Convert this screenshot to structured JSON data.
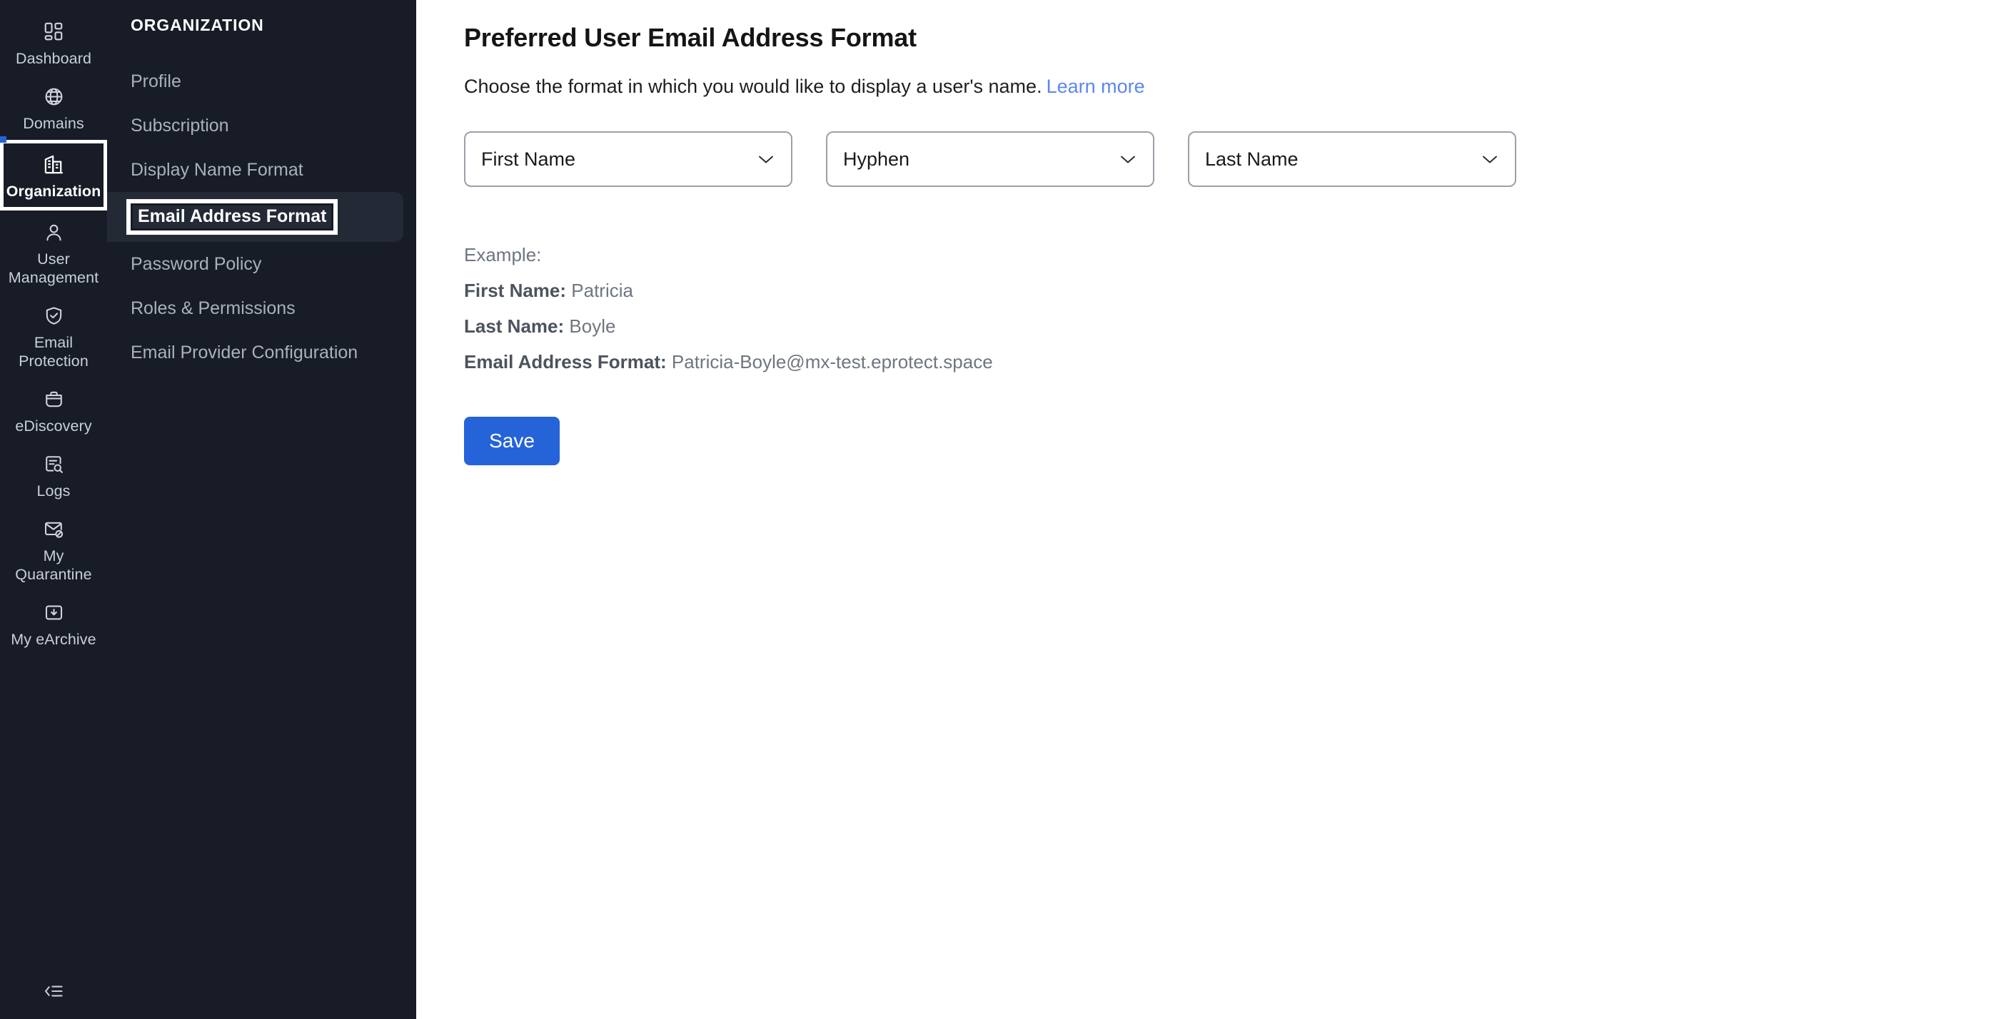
{
  "rail": {
    "items": [
      {
        "label": "Dashboard",
        "icon": "dashboard-grid-icon",
        "active": false
      },
      {
        "label": "Domains",
        "icon": "globe-icon",
        "active": false
      },
      {
        "label": "Organization",
        "icon": "building-icon",
        "active": true
      },
      {
        "label": "User Management",
        "icon": "user-icon",
        "active": false
      },
      {
        "label": "Email Protection",
        "icon": "shield-check-icon",
        "active": false
      },
      {
        "label": "eDiscovery",
        "icon": "briefcase-icon",
        "active": false
      },
      {
        "label": "Logs",
        "icon": "document-search-icon",
        "active": false
      },
      {
        "label": "My Quarantine",
        "icon": "envelope-blocked-icon",
        "active": false
      },
      {
        "label": "My eArchive",
        "icon": "archive-download-icon",
        "active": false
      }
    ],
    "collapse_icon": "collapse-sidebar-icon"
  },
  "subnav": {
    "title": "ORGANIZATION",
    "items": [
      {
        "label": "Profile",
        "active": false
      },
      {
        "label": "Subscription",
        "active": false
      },
      {
        "label": "Display Name Format",
        "active": false
      },
      {
        "label": "Email Address Format",
        "active": true
      },
      {
        "label": "Password Policy",
        "active": false
      },
      {
        "label": "Roles & Permissions",
        "active": false
      },
      {
        "label": "Email Provider Configuration",
        "active": false
      }
    ]
  },
  "main": {
    "title": "Preferred User Email Address Format",
    "description": "Choose the format in which you would like to display a user's name.",
    "learn_more_label": "Learn more",
    "selects": [
      {
        "name": "first-part",
        "value": "First Name"
      },
      {
        "name": "separator",
        "value": "Hyphen"
      },
      {
        "name": "last-part",
        "value": "Last Name"
      }
    ],
    "example": {
      "heading": "Example:",
      "first_name_label": "First Name:",
      "first_name_value": "Patricia",
      "last_name_label": "Last Name:",
      "last_name_value": "Boyle",
      "email_format_label": "Email Address Format:",
      "email_format_value": "Patricia-Boyle@mx-test.eprotect.space"
    },
    "save_label": "Save"
  },
  "colors": {
    "sidebar_bg": "#171c26",
    "sidebar_active_bg": "#232a36",
    "accent_blue": "#2563d9",
    "link_blue": "#5c87ef",
    "focus_ring": "#ffffff"
  }
}
